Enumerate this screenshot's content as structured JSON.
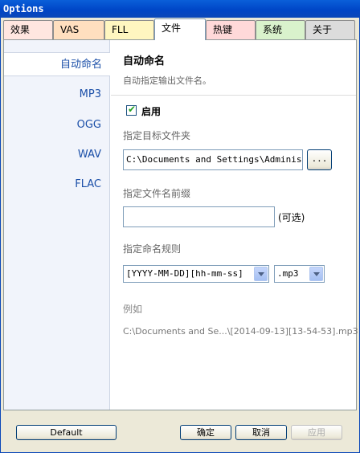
{
  "window": {
    "title": "Options"
  },
  "tabs": [
    {
      "label": "效果",
      "color": "#ffe6e0"
    },
    {
      "label": "VAS",
      "color": "#ffdfbf"
    },
    {
      "label": "FLL",
      "color": "#fff6c0"
    },
    {
      "label": "文件",
      "color": "#ffffff"
    },
    {
      "label": "热键",
      "color": "#ffd9d9"
    },
    {
      "label": "系统",
      "color": "#d9f2cc"
    },
    {
      "label": "关于",
      "color": "#dcdcdc"
    }
  ],
  "sidebar": {
    "items": [
      {
        "label": "自动命名"
      },
      {
        "label": "MP3"
      },
      {
        "label": "OGG"
      },
      {
        "label": "WAV"
      },
      {
        "label": "FLAC"
      }
    ]
  },
  "content": {
    "title": "自动命名",
    "description": "自动指定输出文件名。",
    "enable_label": "启用",
    "enabled": true,
    "target_folder_label": "指定目标文件夹",
    "target_folder_value": "C:\\Documents and Settings\\Administra",
    "browse_label": "...",
    "prefix_label": "指定文件名前缀",
    "prefix_value": "",
    "optional_label": "(可选)",
    "rule_label": "指定命名规则",
    "rule_value": "[YYYY-MM-DD][hh-mm-ss]",
    "ext_value": ".mp3",
    "example_label": "例如",
    "example_value": "C:\\Documents and Se...\\[2014-09-13][13-54-53].mp3"
  },
  "footer": {
    "default_label": "Default",
    "ok_label": "确定",
    "cancel_label": "取消",
    "apply_label": "应用"
  }
}
